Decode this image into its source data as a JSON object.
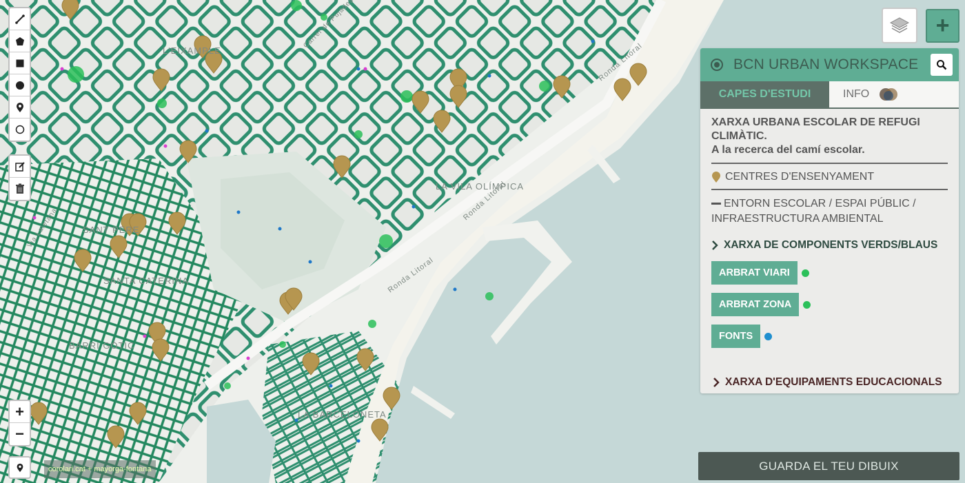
{
  "app": {
    "title": "BCN URBAN WORKSPACE"
  },
  "map": {
    "labels": [
      "LA VILA OLÍMPICA",
      "LA BARCELONETA",
      "SANT PERE",
      "BARRI GÒTIC",
      "SANTA CATERINA",
      "L'EIXAMPLE",
      "Ronda Litoral",
      "Ronda Litoral",
      "Carrer de Pujades",
      "Via Laietana"
    ],
    "attribution": "corolari.cat + mayorga-fontana",
    "colors": {
      "water": "#c5d8d7",
      "land": "#eef0ec",
      "street": "#2f8f6f",
      "pin": "#b69650"
    }
  },
  "draw_tools": [
    {
      "name": "polyline-icon"
    },
    {
      "name": "polygon-icon"
    },
    {
      "name": "rectangle-icon"
    },
    {
      "name": "circle-icon"
    },
    {
      "name": "marker-icon"
    },
    {
      "name": "circle-marker-icon"
    }
  ],
  "edit_tools": [
    {
      "name": "edit-icon"
    },
    {
      "name": "trash-icon"
    }
  ],
  "zoom": {
    "in": "+",
    "out": "−"
  },
  "panel": {
    "tabs": [
      "CAPES D'ESTUDI",
      "INFO"
    ],
    "intro_line1": "XARXA URBANA ESCOLAR DE REFUGI CLIMÀTIC.",
    "intro_line2": "A la recerca del camí escolar.",
    "legend_schools": "CENTRES D'ENSENYAMENT",
    "legend_environment": "ENTORN ESCOLAR / ESPAI PÚBLIC / INFRAESTRUCTURA AMBIENTAL",
    "section_green": "XARXA DE COMPONENTS VERDS/BLAUS",
    "layer_buttons": [
      {
        "label": "ARBRAT VIARI",
        "color": "#2cc05a"
      },
      {
        "label": "ARBRAT ZONA",
        "color": "#2cc05a"
      },
      {
        "label": "FONTS",
        "color": "#1f8fcf"
      }
    ],
    "section_edu": "XARXA D'EQUIPAMENTS EDUCACIONALS"
  },
  "save_button": "GUARDA EL TEU DIBUIX"
}
